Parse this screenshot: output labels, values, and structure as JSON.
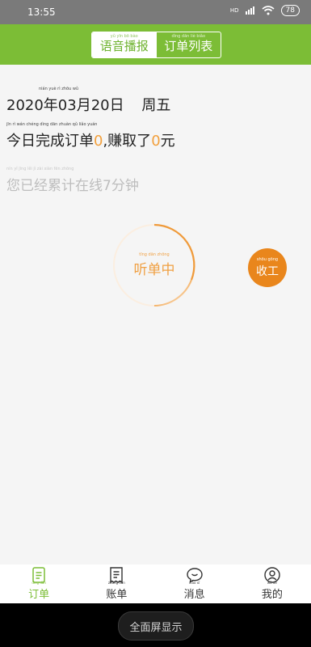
{
  "status_bar": {
    "time": "13:55",
    "network": "HD",
    "battery": "78"
  },
  "header": {
    "tabs": [
      {
        "label": "语音播报",
        "pinyin": "yǔ yīn bō bào",
        "active": true
      },
      {
        "label": "订单列表",
        "pinyin": "dìng dān liè biǎo",
        "active": false
      }
    ]
  },
  "main": {
    "date": {
      "text": "2020年03月20日",
      "weekday": "周五",
      "pinyin": "nián yuè rì zhōu wǔ"
    },
    "summary": {
      "prefix": "今日完成订单",
      "orders": "0",
      "middle": ",赚取了",
      "earned": "0",
      "suffix": "元",
      "pinyin": "jīn rì wán chéng dìng dān zhuàn qǔ liǎo yuán"
    },
    "online": {
      "text": "您已经累计在线7分钟",
      "pinyin": "nín yǐ jīng lěi jì zài xiàn fēn zhōng"
    },
    "listening": {
      "label": "听单中",
      "pinyin": "tīng dān zhōng"
    },
    "stop": {
      "label": "收工",
      "pinyin": "shōu gōng"
    }
  },
  "bottom_nav": [
    {
      "label": "订单",
      "pinyin": "dìng dān",
      "icon": "order-icon",
      "active": true
    },
    {
      "label": "账单",
      "pinyin": "zhàng dān",
      "icon": "bill-icon",
      "active": false
    },
    {
      "label": "消息",
      "pinyin": "xiāo xī",
      "icon": "message-icon",
      "active": false
    },
    {
      "label": "我的",
      "pinyin": "wǒ de",
      "icon": "profile-icon",
      "active": false
    }
  ],
  "system": {
    "fullscreen_label": "全面屏显示"
  },
  "colors": {
    "brand_green": "#7cbd36",
    "accent_orange": "#e9861c"
  }
}
